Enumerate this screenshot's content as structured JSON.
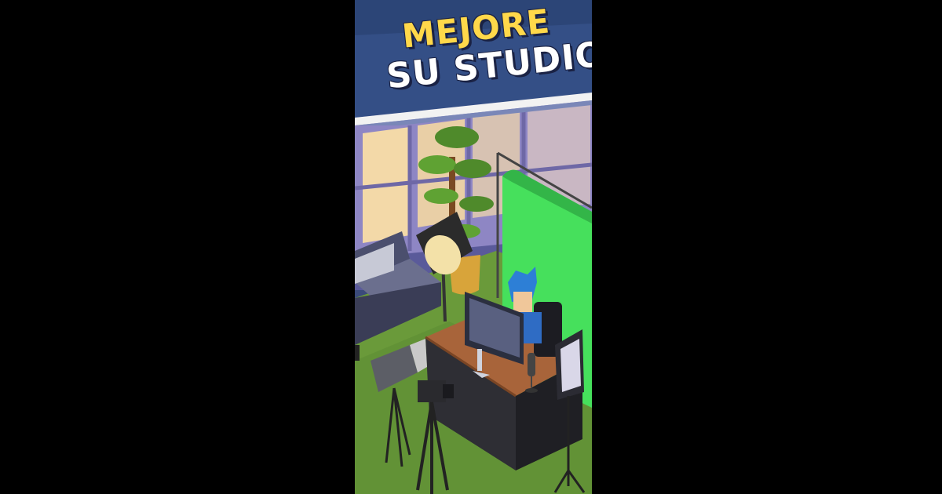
{
  "promo": {
    "headline_line1": "MEJORE",
    "headline_line2": "SU STUDIO"
  },
  "colors": {
    "letterbox": "#000000",
    "banner_blue": "#344f86",
    "headline_yellow": "#ffd84a",
    "headline_white": "#ffffff",
    "green_screen": "#46e05c",
    "grass": "#6a9a3a",
    "desk_wood": "#a8643a"
  },
  "scene": {
    "objects": [
      "window-wall",
      "potted-plant",
      "studio-lamp",
      "sofa",
      "green-screen",
      "streamer-character",
      "desk",
      "monitor",
      "microphone",
      "video-camera",
      "tripod-camera",
      "lightbox"
    ]
  }
}
